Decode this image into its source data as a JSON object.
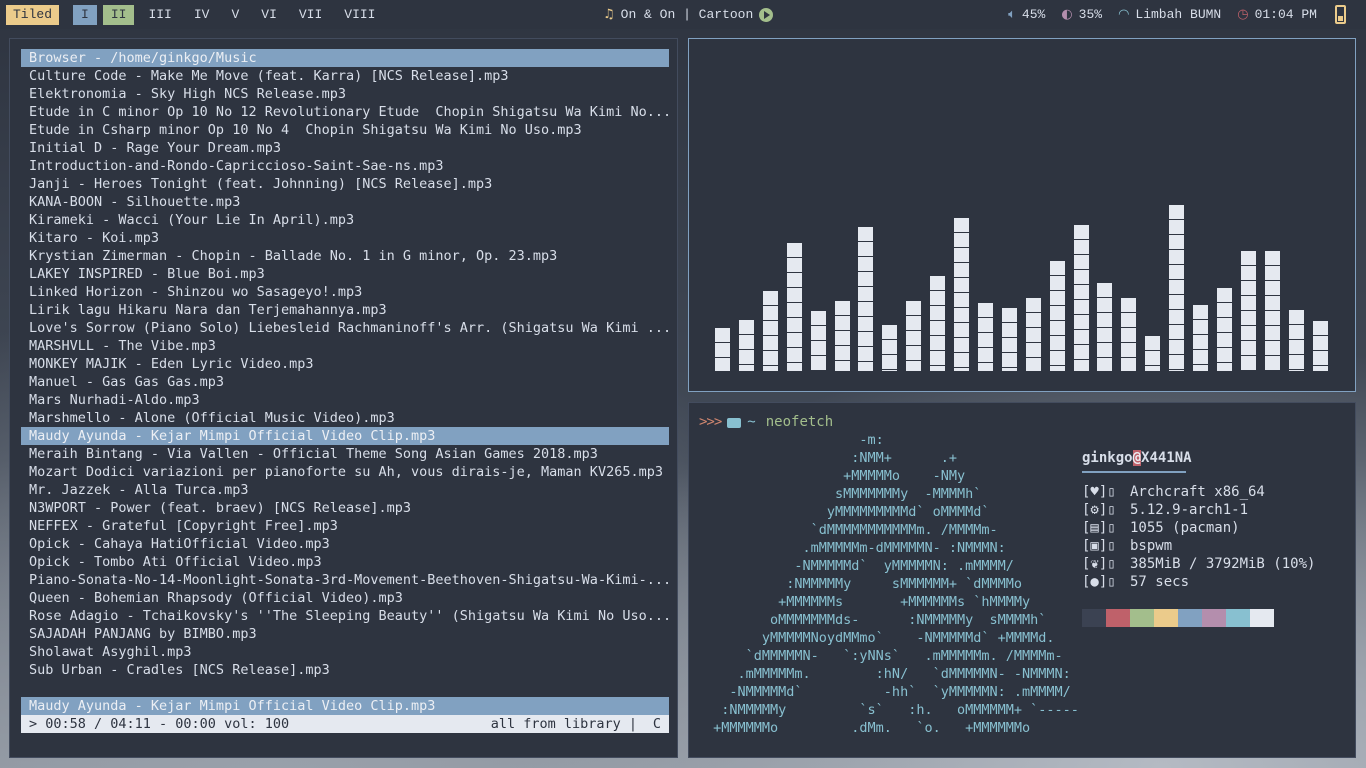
{
  "topbar": {
    "layout": "Tiled",
    "workspaces": [
      "I",
      "II",
      "III",
      "IV",
      "V",
      "VI",
      "VII",
      "VIII"
    ],
    "now_playing": "On & On | Cartoon",
    "volume": "45%",
    "brightness": "35%",
    "wifi": "Limbah BUMN",
    "time": "01:04 PM"
  },
  "player": {
    "header": "Browser - /home/ginkgo/Music",
    "tracks": [
      "Culture Code - Make Me Move (feat. Karra) [NCS Release].mp3",
      "Elektronomia - Sky High NCS Release.mp3",
      "Etude in C minor Op 10 No 12 Revolutionary Etude  Chopin Shigatsu Wa Kimi No...",
      "Etude in Csharp minor Op 10 No 4  Chopin Shigatsu Wa Kimi No Uso.mp3",
      "Initial D - Rage Your Dream.mp3",
      "Introduction-and-Rondo-Capriccioso-Saint-Sae-ns.mp3",
      "Janji - Heroes Tonight (feat. Johnning) [NCS Release].mp3",
      "KANA-BOON - Silhouette.mp3",
      "Kirameki - Wacci (Your Lie In April).mp3",
      "Kitaro - Koi.mp3",
      "Krystian Zimerman - Chopin - Ballade No. 1 in G minor, Op. 23.mp3",
      "LAKEY INSPIRED - Blue Boi.mp3",
      "Linked Horizon - Shinzou wo Sasageyo!.mp3",
      "Lirik lagu Hikaru Nara dan Terjemahannya.mp3",
      "Love's Sorrow (Piano Solo) Liebesleid Rachmaninoff's Arr. (Shigatsu Wa Kimi ...",
      "MARSHVLL - The Vibe.mp3",
      "MONKEY MAJIK - Eden Lyric Video.mp3",
      "Manuel - Gas Gas Gas.mp3",
      "Mars Nurhadi-Aldo.mp3",
      "Marshmello - Alone (Official Music Video).mp3",
      "Maudy Ayunda - Kejar Mimpi Official Video Clip.mp3",
      "Meraih Bintang - Via Vallen - Official Theme Song Asian Games 2018.mp3",
      "Mozart Dodici variazioni per pianoforte su Ah, vous dirais-je, Maman KV265.mp3",
      "Mr. Jazzek - Alla Turca.mp3",
      "N3WPORT - Power (feat. braev) [NCS Release].mp3",
      "NEFFEX - Grateful [Copyright Free].mp3",
      "Opick - Cahaya HatiOfficial Video.mp3",
      "Opick - Tombo Ati Official Video.mp3",
      "Piano-Sonata-No-14-Moonlight-Sonata-3rd-Movement-Beethoven-Shigatsu-Wa-Kimi-...",
      "Queen - Bohemian Rhapsody (Official Video).mp3",
      "Rose Adagio - Tchaikovsky's ''The Sleeping Beauty'' (Shigatsu Wa Kimi No Uso...",
      "SAJADAH PANJANG by BIMBO.mp3",
      "Sholawat Asyghil.mp3",
      "Sub Urban - Cradles [NCS Release].mp3"
    ],
    "selected_index": 20,
    "now_playing": "Maudy Ayunda - Kejar Mimpi Official Video Clip.mp3",
    "progress": "> 00:58 / 04:11 - 00:00 vol: 100",
    "mode": "all from library |",
    "mode_flag": "C"
  },
  "visualizer": {
    "levels": [
      0.26,
      0.31,
      0.48,
      0.77,
      0.36,
      0.42,
      0.87,
      0.28,
      0.42,
      0.57,
      0.92,
      0.41,
      0.38,
      0.44,
      0.66,
      0.88,
      0.53,
      0.44,
      0.21,
      1.0,
      0.4,
      0.5,
      0.72,
      0.72,
      0.37,
      0.3
    ]
  },
  "terminal": {
    "prompt_arrows": ">>>",
    "cwd": "~",
    "command": "neofetch",
    "ascii_art": [
      "                   -m:",
      "                  :NMM+      .+",
      "                 +MMMMMo    -NMy",
      "                sMMMMMMMy  -MMMMh`",
      "               yMMMMMMMMMd` oMMMMd`",
      "             `dMMMMMMMMMMMm. /MMMMm-",
      "            .mMMMMMm-dMMMMMN- :NMMMN:",
      "           -NMMMMMd`  yMMMMMN: .mMMMM/",
      "          :NMMMMMy     sMMMMMM+ `dMMMMo",
      "         +MMMMMMs       +MMMMMMs `hMMMMy",
      "        oMMMMMMMds-      :NMMMMMy  sMMMMh`",
      "       yMMMMMNoydMMmo`    -NMMMMMd` +MMMMd.",
      "     `dMMMMMN-   `:yNNs`   .mMMMMMm. /MMMMm-",
      "    .mMMMMMm.        :hN/   `dMMMMMN- -NMMMN:",
      "   -NMMMMMd`          -hh`  `yMMMMMN: .mMMMM/",
      "  :NMMMMMy         `s`   :h.   oMMMMMM+ `-----",
      " +MMMMMMo         .dMm.   `o.   +MMMMMMo"
    ],
    "user": "ginkgo",
    "at": "@",
    "host": "X441NA",
    "fields": [
      {
        "icon": "heart-icon",
        "glyph": "[♥]▯",
        "value": "Archcraft x86_64"
      },
      {
        "icon": "gear-icon",
        "glyph": "[⚙]▯",
        "value": "5.12.9-arch1-1"
      },
      {
        "icon": "package-icon",
        "glyph": "[▤]▯",
        "value": "1055 (pacman)"
      },
      {
        "icon": "window-icon",
        "glyph": "[▣]▯",
        "value": "bspwm"
      },
      {
        "icon": "leaf-icon",
        "glyph": "[❦]▯",
        "value": "385MiB / 3792MiB (10%)"
      },
      {
        "icon": "bulb-icon",
        "glyph": "[●]▯",
        "value": "57 secs"
      }
    ],
    "palette": [
      "#3b4252",
      "#bf616a",
      "#a3be8c",
      "#ebcb8b",
      "#81a1c1",
      "#b48ead",
      "#88c0d0",
      "#e5e9f0"
    ]
  }
}
